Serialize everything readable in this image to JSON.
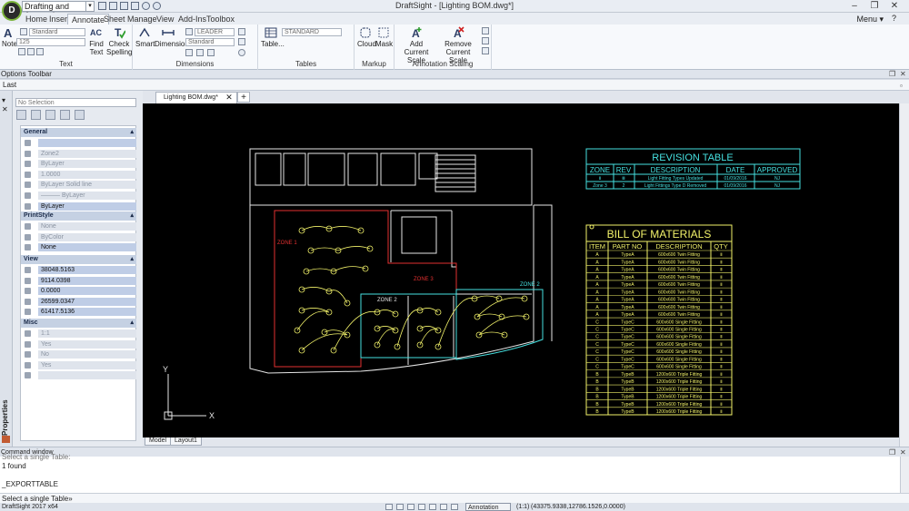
{
  "app": {
    "logo_letter": "D",
    "workspace": "Drafting and Annotation",
    "window_title": "DraftSight - [Lighting BOM.dwg*]"
  },
  "menu": {
    "tabs": [
      "Home",
      "Insert",
      "Annotate",
      "Sheet",
      "Manage",
      "View",
      "Add-Ins",
      "Toolbox"
    ],
    "active_tab": "Annotate",
    "menu_label": "Menu ▾"
  },
  "ribbon": {
    "text_group": {
      "label": "Text",
      "note_label": "Note",
      "style_combo": "Standard",
      "height_combo": "125",
      "find_text": [
        "Find",
        "Text"
      ],
      "check_spelling": [
        "Check",
        "Spelling"
      ]
    },
    "dimensions_group": {
      "label": "Dimensions",
      "smart": "Smart",
      "dimension": "Dimension",
      "leader_combo": "LEADER",
      "standard_combo": "Standard"
    },
    "tables_group": {
      "label": "Tables",
      "table": "Table...",
      "style_combo": "STANDARD"
    },
    "markup_group": {
      "label": "Markup",
      "cloud": "Cloud",
      "mask": "Mask"
    },
    "scaling_group": {
      "label": "Annotation Scaling",
      "add_scale": [
        "Add Current",
        "Scale"
      ],
      "remove_scale": [
        "Remove Current",
        "Scale"
      ]
    }
  },
  "toolbars": {
    "options_label": "Options Toolbar",
    "last_label": "Last"
  },
  "properties": {
    "side_label": "Properties",
    "selection": "No Selection",
    "sections": {
      "general": "General",
      "printstyle": "PrintStyle",
      "view": "View",
      "misc": "Misc"
    },
    "general_rows": [
      "",
      "Zone2",
      "ByLayer",
      "1.0000",
      "ByLayer    Solid line",
      "——— ByLayer",
      "ByLayer"
    ],
    "printstyle_rows": [
      "None",
      "ByColor",
      "None"
    ],
    "view_rows": [
      "38048.5163",
      "9114.0398",
      "0.0000",
      "26599.0347",
      "61417.5136"
    ],
    "misc_rows": [
      "1:1",
      "Yes",
      "No",
      "Yes",
      ""
    ]
  },
  "document": {
    "tab_label": "Lighting BOM.dwg*",
    "close_glyph": "✕",
    "add_glyph": "+",
    "layout_tabs": [
      "Model",
      "Layout1"
    ]
  },
  "drawing": {
    "zones": [
      "ZONE 1",
      "ZONE 2",
      "ZONE 3",
      "ZONE 2"
    ],
    "axis_y": "Y",
    "axis_x": "X",
    "revision_table": {
      "title": "REVISION TABLE",
      "headers": [
        "ZONE",
        "REV",
        "DESCRIPTION",
        "DATE",
        "APPROVED"
      ],
      "rows": [
        [
          "Ⅱ",
          "Ⅲ",
          "Light Fitting Types Updated",
          "01/09/2016",
          "NJ"
        ],
        [
          "Zone 3",
          "2",
          "Light Fittings Type D Removed",
          "01/09/2016",
          "NJ"
        ]
      ]
    },
    "bom_table": {
      "title": "BILL OF MATERIALS",
      "headers": [
        "ITEM",
        "PART NO",
        "DESCRIPTION",
        "QTY"
      ],
      "rows": [
        [
          "A",
          "TypeA",
          "600x600 Twin Fitting",
          "Ⅱ"
        ],
        [
          "A",
          "TypeA",
          "600x600 Twin Fitting",
          "Ⅱ"
        ],
        [
          "A",
          "TypeA",
          "600x600 Twin Fitting",
          "Ⅱ"
        ],
        [
          "A",
          "TypeA",
          "600x600 Twin Fitting",
          "Ⅱ"
        ],
        [
          "A",
          "TypeA",
          "600x600 Twin Fitting",
          "Ⅱ"
        ],
        [
          "A",
          "TypeA",
          "600x600 Twin Fitting",
          "Ⅱ"
        ],
        [
          "A",
          "TypeA",
          "600x600 Twin Fitting",
          "Ⅱ"
        ],
        [
          "A",
          "TypeA",
          "600x600 Twin Fitting",
          "Ⅱ"
        ],
        [
          "A",
          "TypeA",
          "600x600 Twin Fitting",
          "Ⅱ"
        ],
        [
          "C",
          "TypeC",
          "600x600 Single Fitting",
          "Ⅱ"
        ],
        [
          "C",
          "TypeC",
          "600x600 Single Fitting",
          "Ⅱ"
        ],
        [
          "C",
          "TypeC",
          "600x600 Single Fitting",
          "Ⅱ"
        ],
        [
          "C",
          "TypeC",
          "600x600 Single Fitting",
          "Ⅱ"
        ],
        [
          "C",
          "TypeC",
          "600x600 Single Fitting",
          "Ⅱ"
        ],
        [
          "C",
          "TypeC",
          "600x600 Single Fitting",
          "Ⅱ"
        ],
        [
          "C",
          "TypeC",
          "600x600 Single Fitting",
          "Ⅱ"
        ],
        [
          "B",
          "TypeB",
          "1200x600 Triple Fitting",
          "Ⅱ"
        ],
        [
          "B",
          "TypeB",
          "1200x600 Triple Fitting",
          "Ⅱ"
        ],
        [
          "B",
          "TypeB",
          "1200x600 Triple Fitting",
          "Ⅱ"
        ],
        [
          "B",
          "TypeB",
          "1200x600 Triple Fitting",
          "Ⅱ"
        ],
        [
          "B",
          "TypeB",
          "1200x600 Triple Fitting",
          "Ⅱ"
        ],
        [
          "B",
          "TypeB",
          "1200x600 Triple Fitting",
          "Ⅱ"
        ]
      ]
    }
  },
  "command": {
    "title": "Command window",
    "lines": [
      "Select a single Table:",
      "1 found",
      "",
      "_EXPORTTABLE"
    ],
    "prompt": "Select a single Table»"
  },
  "status": {
    "app_version": "DraftSight 2017 x64",
    "annotation": "Annotation",
    "scale": "(1:1)",
    "coords": "(43375.9338,12786.1526,0.0000)"
  },
  "colors": {
    "canvas": "#000000",
    "cad_white": "#e6e6e6",
    "cad_cyan": "#46e0e0",
    "cad_yellow": "#f2f26a",
    "cad_red": "#e23030",
    "ribbon_bg": "#f7f9fc"
  }
}
